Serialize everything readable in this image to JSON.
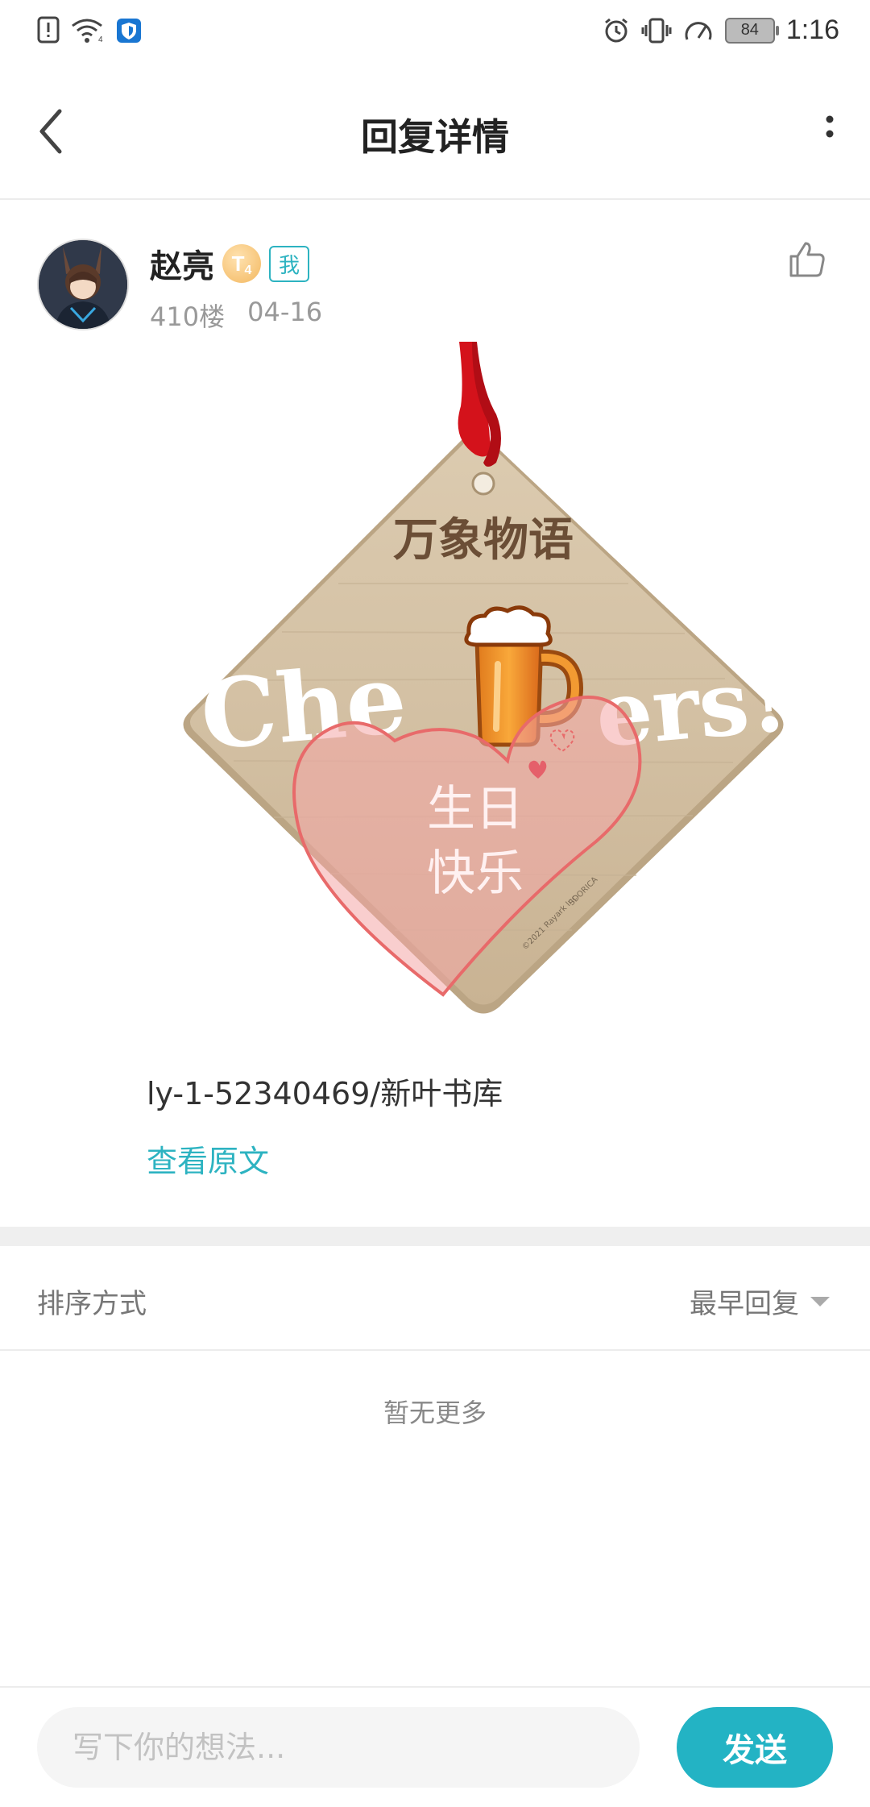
{
  "status_bar": {
    "time": "1:16",
    "battery": "84"
  },
  "nav": {
    "title": "回复详情"
  },
  "reply": {
    "author": "赵亮",
    "level": "T",
    "level_sub": "4",
    "me_tag": "我",
    "floor": "410楼",
    "date": "04-16",
    "image": {
      "brand": "万象物语",
      "cheers_left": "Che",
      "cheers_right": "ers!",
      "heart_line1": "生日",
      "heart_line2": "快乐",
      "copyright": "©2021 Rayark Inc.",
      "sdorica": "SDORICA"
    },
    "text": "ly-1-52340469/新叶书库",
    "view_original": "查看原文"
  },
  "sort": {
    "label": "排序方式",
    "value": "最早回复"
  },
  "empty_text": "暂无更多",
  "composer": {
    "placeholder": "写下你的想法...",
    "send_label": "发送"
  },
  "colors": {
    "accent": "#23b3c4",
    "link": "#2db3c1"
  }
}
